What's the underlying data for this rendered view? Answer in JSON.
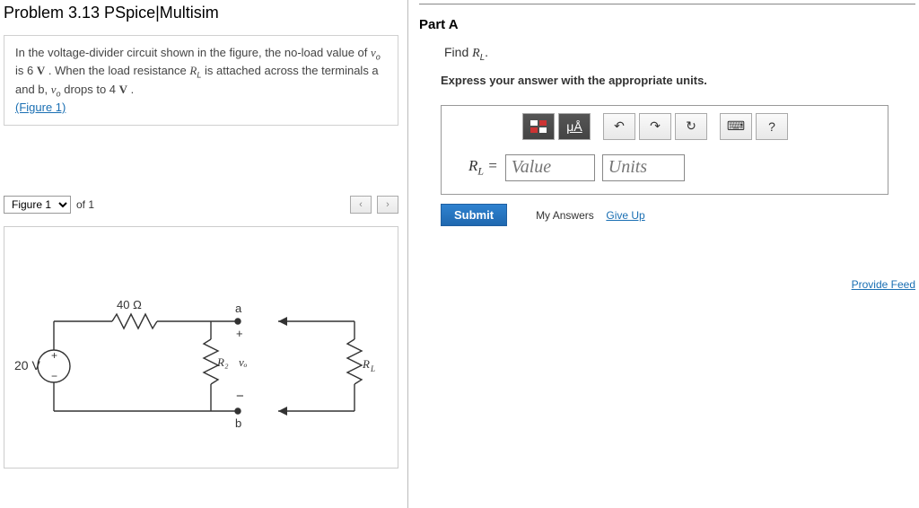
{
  "problem_title": "Problem 3.13 PSpice|Multisim",
  "problem_text": {
    "line1": "In the voltage-divider circuit shown in the figure, the no-load value of ",
    "vo_var": "v",
    "vo_sub": "o",
    "line2": " is 6 ",
    "V1": "V",
    "line3": " . When the load resistance ",
    "RL_var": "R",
    "RL_sub": "L",
    "line4": " is attached across the terminals a and b, ",
    "line5": " drops to 4 ",
    "V2": "V",
    "line6": " .",
    "figure_link": "(Figure 1)"
  },
  "figure": {
    "selected": "Figure 1",
    "of_label": "of 1",
    "prev": "‹",
    "next": "›",
    "source_label": "20 V",
    "r1_label": "40 Ω",
    "r2_label": "R₂",
    "vo_label": "vₒ",
    "rl_label": "R_L",
    "node_a": "a",
    "node_b": "b",
    "plus": "+",
    "minus": "−"
  },
  "part": {
    "label": "Part A",
    "find_pre": "Find ",
    "find_var": "R",
    "find_sub": "L",
    "find_post": ".",
    "units_instruction": "Express your answer with the appropriate units."
  },
  "toolbar": {
    "templates_icon": "▭",
    "units_icon": "μÅ",
    "undo": "↶",
    "redo": "↷",
    "reset": "↻",
    "keyboard": "⌨",
    "help": "?"
  },
  "input": {
    "label_var": "R",
    "label_sub": "L",
    "label_eq": " = ",
    "value_placeholder": "Value",
    "units_placeholder": "Units"
  },
  "actions": {
    "submit": "Submit",
    "my_answers": "My Answers",
    "give_up": "Give Up"
  },
  "feedback_link": "Provide Feed"
}
